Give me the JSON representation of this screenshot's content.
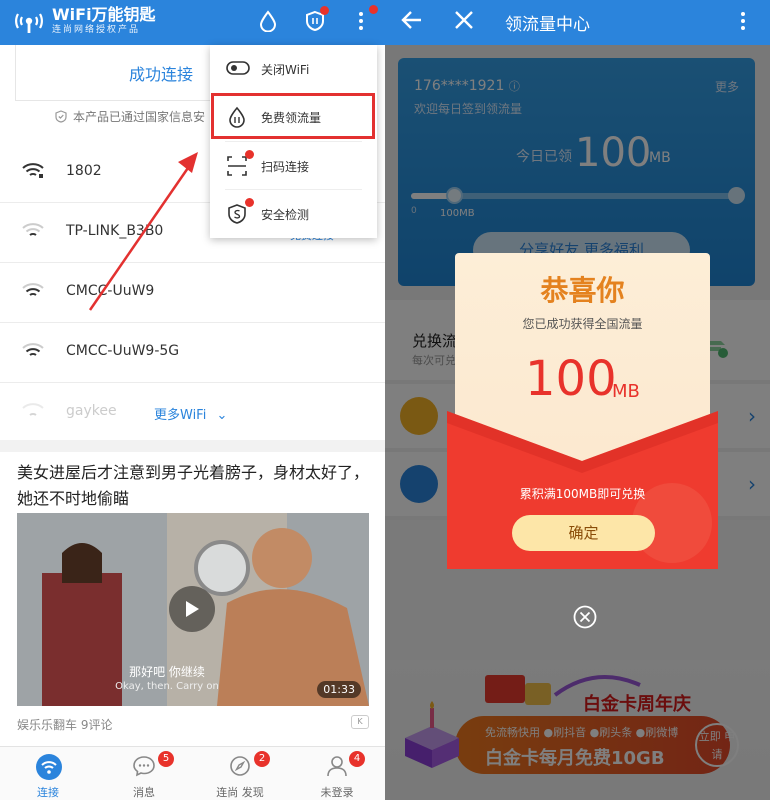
{
  "left": {
    "brand": {
      "title": "WiFi万能钥匙",
      "subtitle": "连尚网络授权产品"
    },
    "banner": {
      "text": "成功连接"
    },
    "notice": "本产品已通过国家信息安",
    "wifi_list": [
      {
        "name": "1802"
      },
      {
        "name": "TP-LINK_B3B0",
        "action": "免费连接"
      },
      {
        "name": "CMCC-UuW9"
      },
      {
        "name": "CMCC-UuW9-5G"
      },
      {
        "name": "gaykee"
      }
    ],
    "more_wifi": "更多WiFi",
    "menu": [
      {
        "label": "关闭WiFi",
        "icon": "toggle-icon",
        "dot": false
      },
      {
        "label": "免费领流量",
        "icon": "data-drop-icon",
        "dot": false
      },
      {
        "label": "扫码连接",
        "icon": "scan-icon",
        "dot": true
      },
      {
        "label": "安全检测",
        "icon": "shield-icon",
        "dot": true
      }
    ],
    "news": {
      "title": "美女进屋后才注意到男子光着膀子，身材太好了，她还不时地偷瞄",
      "subtitle_cn": "那好吧 你继续",
      "subtitle_en": "Okay, then. Carry on",
      "duration": "01:33",
      "source": "娱乐乐翻车 9评论",
      "close_tag": "K"
    },
    "nav": [
      {
        "label": "连接",
        "badge": "",
        "active": true
      },
      {
        "label": "消息",
        "badge": "5",
        "active": false
      },
      {
        "label": "连尚 发现",
        "badge": "2",
        "active": false
      },
      {
        "label": "未登录",
        "badge": "4",
        "active": false
      }
    ],
    "accent": "#2b84dc",
    "highlight_color": "#e33130"
  },
  "right": {
    "title": "领流量中心",
    "card": {
      "phone": "176****1921",
      "more": "更多",
      "welcome": "欢迎每日签到领流量",
      "today_label": "今日已领",
      "today_value": "100",
      "today_unit": "MB",
      "slider_min": "0",
      "slider_value": "100MB",
      "slider_fraction": 0.13,
      "share_btn": "分享好友 更多福利"
    },
    "exchange_title": "兑换流",
    "exchange_sub": "每次可兑",
    "popup": {
      "title": "恭喜你",
      "sub": "您已成功获得全国流量",
      "amount": "100",
      "unit": "MB",
      "info": "累积满100MB即可兑换",
      "confirm": "确定"
    },
    "promo": {
      "title": "白金卡周年庆",
      "tags": "免流畅快用 ●刷抖音 ●刷头条 ●刷微博",
      "gb": "白金卡每月免费10GB",
      "cta": "立即 申请"
    }
  }
}
